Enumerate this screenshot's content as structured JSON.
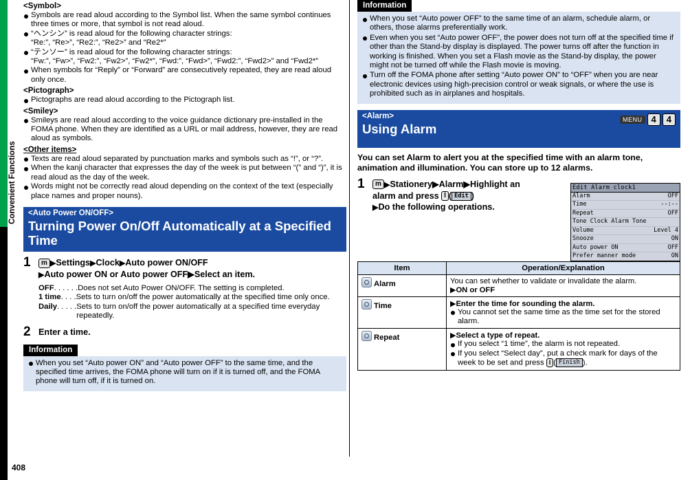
{
  "page": {
    "number": "408",
    "chapter": "Convenient Functions"
  },
  "left": {
    "symbol_header": "<Symbol>",
    "symbol_items": [
      "Symbols are read aloud according to the Symbol list. When the same symbol continues three times or more, that symbol is not read aloud.",
      "“ヘンシン” is read aloud for the following character strings:",
      "“テンソー” is read aloud for the following character strings:",
      "When symbols for “Reply” or “Forward” are consecutively repeated, they are read aloud only once."
    ],
    "symbol_sub1": "“Re:”, “Re>”, “Re2:”, “Re2>” and “Re2*”",
    "symbol_sub2": "“Fw:”, “Fw>”, “Fw2:”, “Fw2>”, “Fw2*”, “Fwd:”, “Fwd>”, “Fwd2:”, “Fwd2>” and “Fwd2*”",
    "pictograph_header": "<Pictograph>",
    "pictograph_items": [
      "Pictographs are read aloud according to the Pictograph list."
    ],
    "smiley_header": "<Smiley>",
    "smiley_items": [
      "Smileys are read aloud according to the voice guidance dictionary pre-installed in the FOMA phone. When they are identified as a URL or mail address, however, they are read aloud as symbols."
    ],
    "other_header": "<Other items>",
    "other_items": [
      "Texts are read aloud separated by punctuation marks and symbols such as “!”, or “?”.",
      "When the kanji character that expresses the day of the week is put between “(” and “)”, it is read aloud as the day of the week.",
      "Words might not be correctly read aloud depending on the context of the text (especially place names and proper nouns)."
    ],
    "section": {
      "sub": "<Auto Power ON/OFF>",
      "title": "Turning Power On/Off Automatically at a Specified Time"
    },
    "step1": {
      "num": "1",
      "line1_keys": [
        "m",
        "Settings",
        "Clock",
        "Auto power ON/OFF"
      ],
      "line2": "Auto power ON or Auto power OFF▶Select an item."
    },
    "defs": [
      {
        "term": "OFF",
        "dots": ". . . . . .",
        "desc": "Does not set Auto Power ON/OFF. The setting is completed."
      },
      {
        "term": "1 time",
        "dots": ". . . .",
        "desc": "Sets to turn on/off the power automatically at the specified time only once."
      },
      {
        "term": "Daily",
        "dots": ". . . . .",
        "desc": "Sets to turn on/off the power automatically at a specified time everyday repeatedly."
      }
    ],
    "step2": {
      "num": "2",
      "text": "Enter a time."
    },
    "info": {
      "header": "Information",
      "items": [
        "When you set “Auto power ON” and “Auto power OFF” to the same time, and the specified time arrives, the FOMA phone will turn on if it is turned off, and the FOMA phone will turn off, if it is turned on."
      ]
    }
  },
  "right": {
    "info_top": {
      "header": "Information",
      "items": [
        "When you set “Auto power OFF” to the same time of an alarm, schedule alarm, or others, those alarms preferentially work.",
        "Even when you set “Auto power OFF”, the power does not turn off at the specified time if other than the Stand-by display is displayed. The power turns off after the function in working is finished. When you set a Flash movie as the Stand-by display, the power might not be turned off while the Flash movie is moving.",
        "Turn off the FOMA phone after setting “Auto power ON” to “OFF” when you are near electronic devices using high-precision control or weak signals, or where the use is prohibited such as in airplanes and hospitals."
      ]
    },
    "section": {
      "sub": "<Alarm>",
      "title": "Using Alarm",
      "menu_key": "MENU",
      "key1": "4",
      "key2": "4"
    },
    "lead": "You can set Alarm to alert you at the specified time with an alarm tone, animation and illumination. You can store up to 12 alarms.",
    "step1": {
      "num": "1",
      "line1": "Stationery▶Alarm▶Highlight an",
      "line2_a": "alarm and press",
      "line2_btn": "Edit",
      "line3": "Do the following operations."
    },
    "phone_screen": {
      "title": "Edit Alarm clock1",
      "rows": [
        {
          "label": "Alarm",
          "value": "OFF"
        },
        {
          "label": "Time",
          "value": "--:--"
        },
        {
          "label": "Repeat",
          "value": "OFF"
        },
        {
          "label": "Tone  Clock Alarm Tone",
          "value": ""
        },
        {
          "label": "Volume",
          "value": "Level 4"
        },
        {
          "label": "Snooze",
          "value": "ON"
        },
        {
          "label": "Auto power ON",
          "value": "OFF"
        },
        {
          "label": "Prefer manner mode",
          "value": "ON"
        }
      ]
    },
    "table": {
      "headers": [
        "Item",
        "Operation/Explanation"
      ],
      "rows": [
        {
          "item": "Alarm",
          "icon": "alarm-icon",
          "lines": [
            {
              "type": "text",
              "text": "You can set whether to validate or invalidate the alarm."
            },
            {
              "type": "arrow-bold",
              "text": "ON or OFF"
            }
          ]
        },
        {
          "item": "Time",
          "icon": "clock-icon",
          "lines": [
            {
              "type": "arrow-bold",
              "text": "Enter the time for sounding the alarm."
            },
            {
              "type": "bullet",
              "text": "You cannot set the same time as the time set for the stored alarm."
            }
          ]
        },
        {
          "item": "Repeat",
          "icon": "repeat-icon",
          "lines": [
            {
              "type": "arrow-bold",
              "text": "Select a type of repeat."
            },
            {
              "type": "bullet",
              "text": "If you select “1 time”, the alarm is not repeated."
            },
            {
              "type": "bullet-finish",
              "text": "If you select “Select day”, put a check mark for days of the week to be set and press",
              "key": "l",
              "lcd": "Finish"
            }
          ]
        }
      ]
    }
  }
}
